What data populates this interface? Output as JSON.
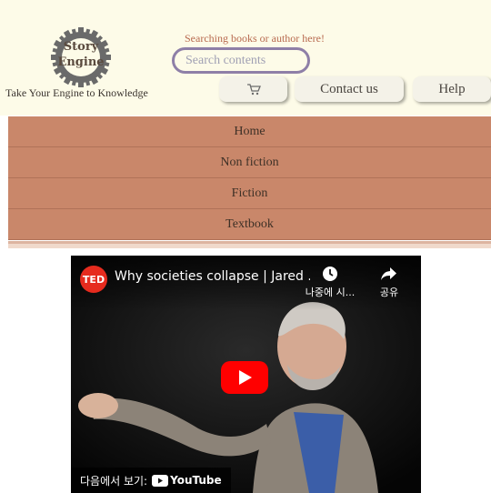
{
  "brand": {
    "logo_text_line1": "Story",
    "logo_text_line2": "Engine",
    "tagline": "Take Your Engine to Knowledge"
  },
  "search": {
    "label": "Searching books or author here!",
    "placeholder": "Search contents"
  },
  "header_buttons": {
    "cart_icon": "cart-icon",
    "contact_label": "Contact us",
    "help_label": "Help"
  },
  "nav": {
    "items": [
      "Home",
      "Non fiction",
      "Fiction",
      "Textbook"
    ]
  },
  "video": {
    "channel_logo_text": "TED",
    "title": "Why societies collapse | Jared ...",
    "watch_later_label": "나중에 시...",
    "share_label": "공유",
    "watch_on_label": "다음에서 보기:",
    "youtube_label": "YouTube"
  },
  "colors": {
    "header_bg": "#fdfbe8",
    "nav_bg": "#c9876a",
    "accent_text": "#b86a4f",
    "search_border": "#8e7fa7",
    "youtube_red": "#ff0000",
    "ted_red": "#e62b1e"
  }
}
